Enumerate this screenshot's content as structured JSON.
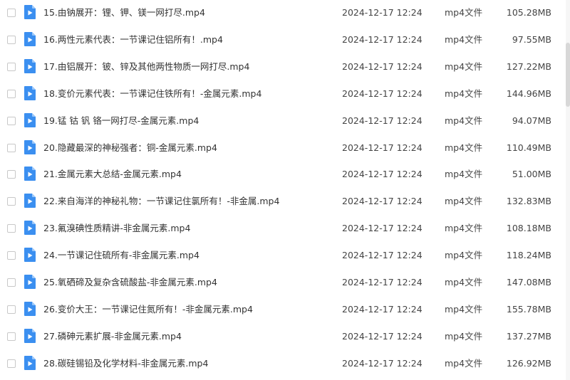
{
  "file_list": {
    "files": [
      {
        "name": "15.由钠展开：锂、钾、镁一网打尽.mp4",
        "date": "2024-12-17 12:24",
        "type": "mp4文件",
        "size": "105.28MB"
      },
      {
        "name": "16.两性元素代表：一节课记住铝所有！.mp4",
        "date": "2024-12-17 12:24",
        "type": "mp4文件",
        "size": "97.55MB"
      },
      {
        "name": "17.由铝展开：铍、锌及其他两性物质一网打尽.mp4",
        "date": "2024-12-17 12:24",
        "type": "mp4文件",
        "size": "127.22MB"
      },
      {
        "name": "18.变价元素代表：一节课记住铁所有！-金属元素.mp4",
        "date": "2024-12-17 12:24",
        "type": "mp4文件",
        "size": "144.96MB"
      },
      {
        "name": "19.锰 钴 钒 铬一网打尽-金属元素.mp4",
        "date": "2024-12-17 12:24",
        "type": "mp4文件",
        "size": "94.07MB"
      },
      {
        "name": "20.隐藏最深的神秘强者：铜-金属元素.mp4",
        "date": "2024-12-17 12:24",
        "type": "mp4文件",
        "size": "110.49MB"
      },
      {
        "name": "21.金属元素大总结-金属元素.mp4",
        "date": "2024-12-17 12:24",
        "type": "mp4文件",
        "size": "51.00MB"
      },
      {
        "name": "22.来自海洋的神秘礼物：一节课记住氯所有！-非金属.mp4",
        "date": "2024-12-17 12:24",
        "type": "mp4文件",
        "size": "132.83MB"
      },
      {
        "name": "23.氟溴碘性质精讲-非金属元素.mp4",
        "date": "2024-12-17 12:24",
        "type": "mp4文件",
        "size": "108.18MB"
      },
      {
        "name": "24.一节课记住硫所有-非金属元素.mp4",
        "date": "2024-12-17 12:24",
        "type": "mp4文件",
        "size": "118.24MB"
      },
      {
        "name": "25.氧硒碲及复杂含硫酸盐-非金属元素.mp4",
        "date": "2024-12-17 12:24",
        "type": "mp4文件",
        "size": "147.08MB"
      },
      {
        "name": "26.变价大王：一节课记住氮所有！-非金属元素.mp4",
        "date": "2024-12-17 12:24",
        "type": "mp4文件",
        "size": "155.78MB"
      },
      {
        "name": "27.磷砷元素扩展-非金属元素.mp4",
        "date": "2024-12-17 12:24",
        "type": "mp4文件",
        "size": "137.27MB"
      },
      {
        "name": "28.碳硅锡铅及化学材料-非金属元素.mp4",
        "date": "2024-12-17 12:24",
        "type": "mp4文件",
        "size": "126.92MB"
      }
    ],
    "icon": "video-file-icon",
    "colors": {
      "icon_blue": "#3b8ff0",
      "icon_fold": "#9cc8fa",
      "text": "#333333"
    }
  }
}
